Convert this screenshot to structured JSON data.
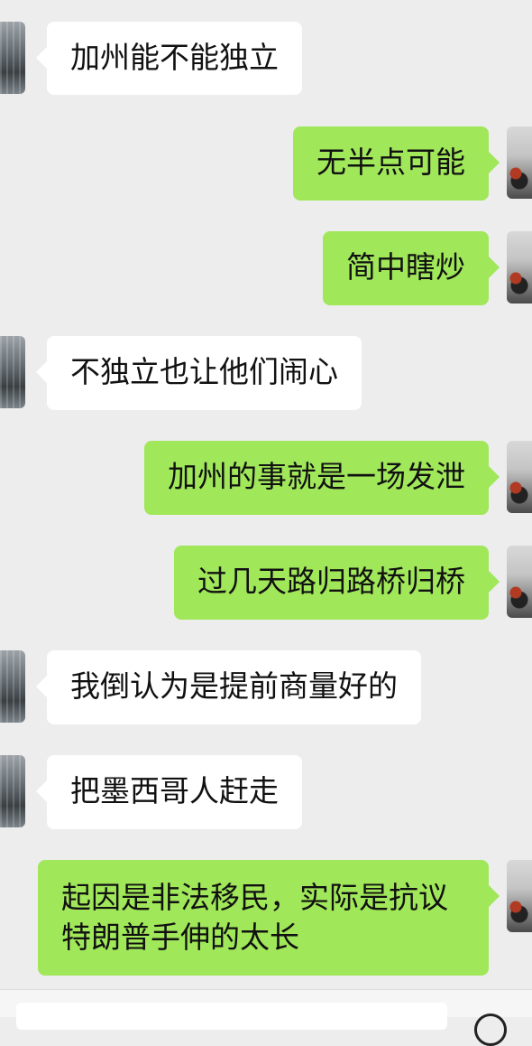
{
  "messages": [
    {
      "side": "in",
      "text": "加州能不能独立"
    },
    {
      "side": "out",
      "text": "无半点可能"
    },
    {
      "side": "out",
      "text": "简中瞎炒"
    },
    {
      "side": "in",
      "text": "不独立也让他们闹心"
    },
    {
      "side": "out",
      "text": "加州的事就是一场发泄"
    },
    {
      "side": "out",
      "text": "过几天路归路桥归桥"
    },
    {
      "side": "in",
      "text": "我倒认为是提前商量好的"
    },
    {
      "side": "in",
      "text": "把墨西哥人赶走"
    },
    {
      "side": "out",
      "lines": [
        "起因是非法移民，实际是抗议",
        "特朗普手伸的太长"
      ]
    }
  ],
  "colors": {
    "background": "#ededed",
    "incoming_bubble": "#ffffff",
    "outgoing_bubble": "#a0e75a"
  },
  "icons": {
    "incoming_avatar": "avatar-city-street",
    "outgoing_avatar": "avatar-motorcycle",
    "voice": "voice-icon"
  }
}
